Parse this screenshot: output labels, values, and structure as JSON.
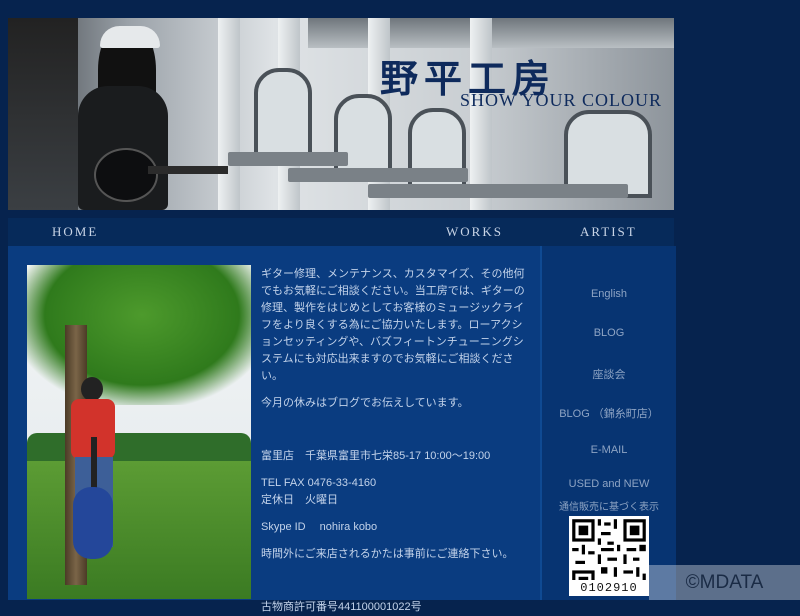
{
  "header": {
    "logo": "野平工房",
    "tagline": "SHOW YOUR COLOUR"
  },
  "nav": {
    "home": "HOME",
    "works": "WORKS",
    "artist": "ARTIST"
  },
  "content": {
    "intro": "ギター修理、メンテナンス、カスタマイズ、その他何でもお気軽にご相談ください。当工房では、ギターの修理、製作をはじめとしてお客様のミュージックライフをより良くする為にご協力いたします。ローアクションセッティングや、バズフィートンチューニングシステムにも対応出来ますのでお気軽にご相談ください。",
    "holiday_note": "今月の休みはブログでお伝えしています。",
    "shop": "富里店　千葉県富里市七栄85-17 10:00～19:00",
    "tel": "TEL FAX 0476-33-4160",
    "closed": "定休日　火曜日",
    "skype": "Skype ID　 nohira kobo",
    "visit_note": "時間外にご来店されるかたは事前にご連絡下さい。",
    "license": "古物商許可番号441100001022号"
  },
  "sidebar": {
    "english": "English",
    "blog": "BLOG",
    "lecture": "座談会",
    "blog_branch": "BLOG （錦糸町店）",
    "email": "E-MAIL",
    "used_new": "USED and NEW",
    "law": "通信販売に基づく表示",
    "qr_number": "0102910"
  },
  "watermark": "©MDATA",
  "colors": {
    "page_bg": "#06234e",
    "content_bg": "#0a3c80",
    "sidebar_bg": "#073472",
    "text": "#c3d3ea"
  }
}
